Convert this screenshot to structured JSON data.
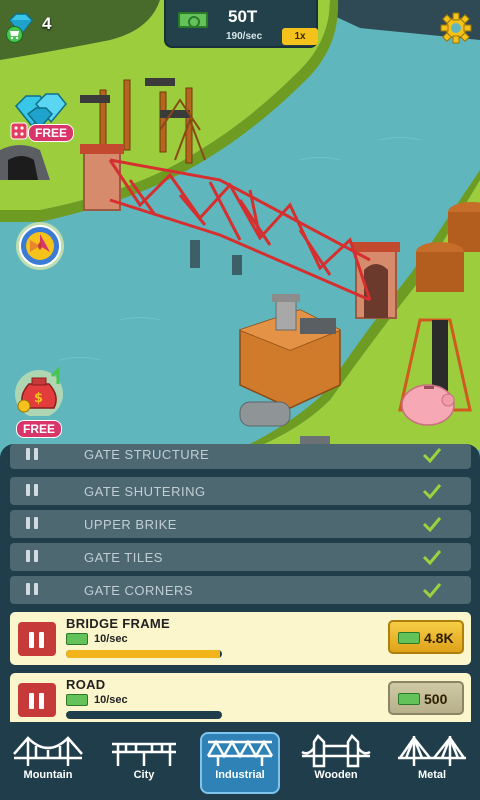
{
  "hud": {
    "gems": "4",
    "money_total": "50T",
    "money_rate": "190/sec",
    "multiplier": "1x"
  },
  "side": {
    "gem_offer_label": "FREE",
    "cash_offer_label": "FREE"
  },
  "upgrades_done": [
    {
      "name": "GATE STRUCTURE"
    },
    {
      "name": "GATE SHUTERING"
    },
    {
      "name": "UPPER BRIKE"
    },
    {
      "name": "GATE TILES"
    },
    {
      "name": "GATE CORNERS"
    }
  ],
  "upgrades_active": [
    {
      "name": "BRIDGE FRAME",
      "rate": "10/sec",
      "price": "4.8K",
      "progress": 0.99,
      "affordable": true
    },
    {
      "name": "ROAD",
      "rate": "10/sec",
      "price": "500",
      "progress": 0.0,
      "affordable": false
    }
  ],
  "nav": [
    {
      "label": "Mountain",
      "icon": "suspension-bridge-icon"
    },
    {
      "label": "City",
      "icon": "beam-bridge-icon"
    },
    {
      "label": "Industrial",
      "icon": "truss-bridge-icon",
      "selected": true
    },
    {
      "label": "Wooden",
      "icon": "tower-bridge-icon"
    },
    {
      "label": "Metal",
      "icon": "cable-bridge-icon"
    }
  ],
  "colors": {
    "water": "#5fb7bd",
    "grass": "#9bcd3c",
    "bridge": "#d62f2f",
    "panel": "#1f3d4a",
    "accent_gold": "#f2b41a"
  }
}
